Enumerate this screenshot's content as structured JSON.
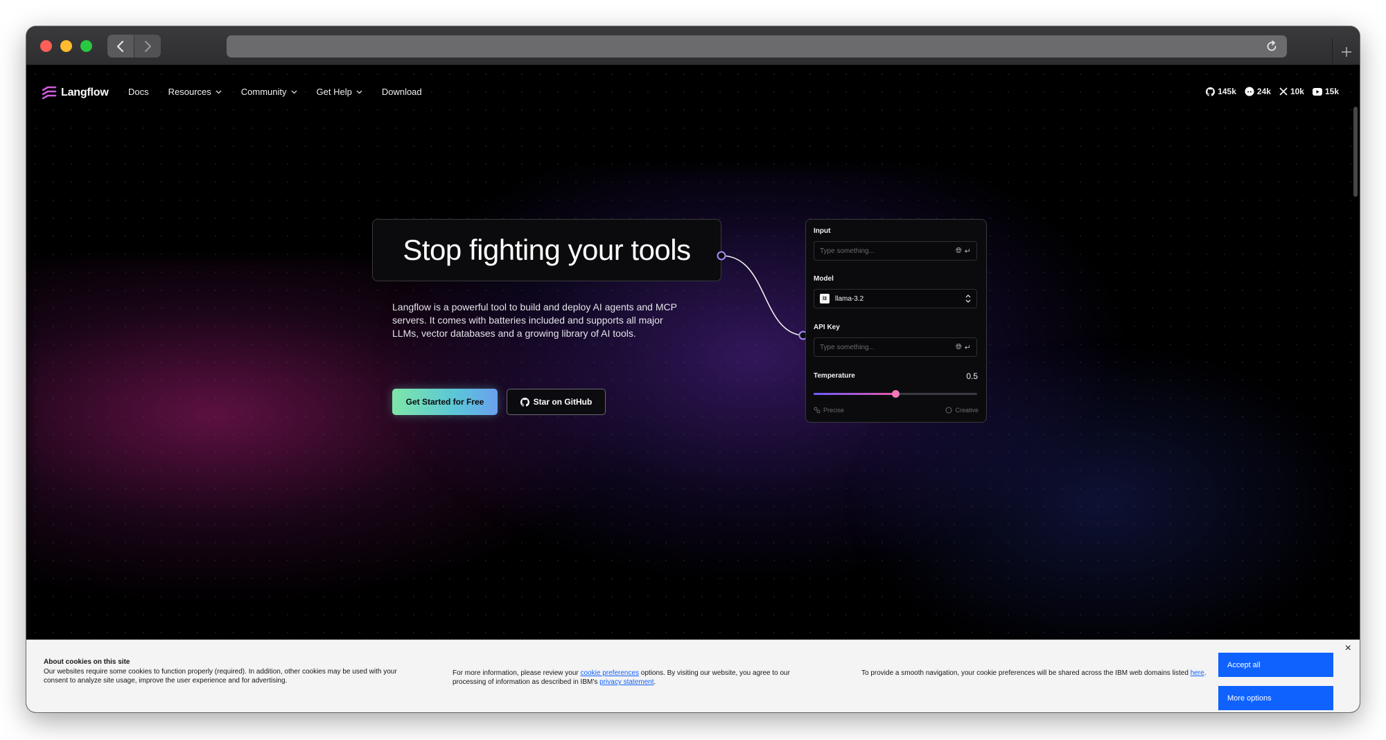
{
  "browser": {
    "url": "",
    "icons": {
      "back": "chevron-left-icon",
      "forward": "chevron-right-icon",
      "reload": "reload-icon",
      "new_tab": "plus-icon"
    }
  },
  "nav": {
    "logo_text": "Langflow",
    "items": [
      {
        "label": "Docs",
        "dropdown": false
      },
      {
        "label": "Resources",
        "dropdown": true
      },
      {
        "label": "Community",
        "dropdown": true
      },
      {
        "label": "Get Help",
        "dropdown": true
      },
      {
        "label": "Download",
        "dropdown": false
      }
    ],
    "socials": [
      {
        "icon": "github-icon",
        "count": "145k"
      },
      {
        "icon": "discord-icon",
        "count": "24k"
      },
      {
        "icon": "x-icon",
        "count": "10k"
      },
      {
        "icon": "youtube-icon",
        "count": "15k"
      }
    ]
  },
  "hero": {
    "headline": "Stop fighting your tools",
    "description": "Langflow is a powerful tool to build and deploy AI agents and MCP servers. It comes with batteries included and supports all major LLMs, vector databases and a growing library of AI tools.",
    "primary_button": "Get Started for Free",
    "secondary_button": "Star on GitHub"
  },
  "component_card": {
    "input_label": "Input",
    "input_placeholder": "Type something...",
    "model_label": "Model",
    "model_badge": "l3",
    "model_value": "llama-3.2",
    "api_key_label": "API Key",
    "api_key_placeholder": "Type something...",
    "temperature_label": "Temperature",
    "temperature_value": "0.5",
    "temperature_fraction": 0.5,
    "left_hint": "Precise",
    "right_hint": "Creative"
  },
  "cookie_banner": {
    "title": "About cookies on this site",
    "col1": "Our websites require some cookies to function properly (required). In addition, other cookies may be used with your consent to analyze site usage, improve the user experience and for advertising.",
    "col2_before": "For more information, please review your ",
    "col2_link1": "cookie preferences",
    "col2_mid": " options. By visiting our website, you agree to our processing of information as described in IBM’s ",
    "col2_link2": "privacy statement",
    "col2_after": ".",
    "col3_before": "To provide a smooth navigation, your cookie preferences will be shared across the IBM web domains listed ",
    "col3_link": "here",
    "col3_after": ".",
    "accept_label": "Accept all",
    "options_label": "More options",
    "close_glyph": "×"
  },
  "colors": {
    "accent_purple": "#8b5cf6",
    "ibm_blue": "#0f62fe",
    "slider_thumb": "#f07ab8"
  }
}
